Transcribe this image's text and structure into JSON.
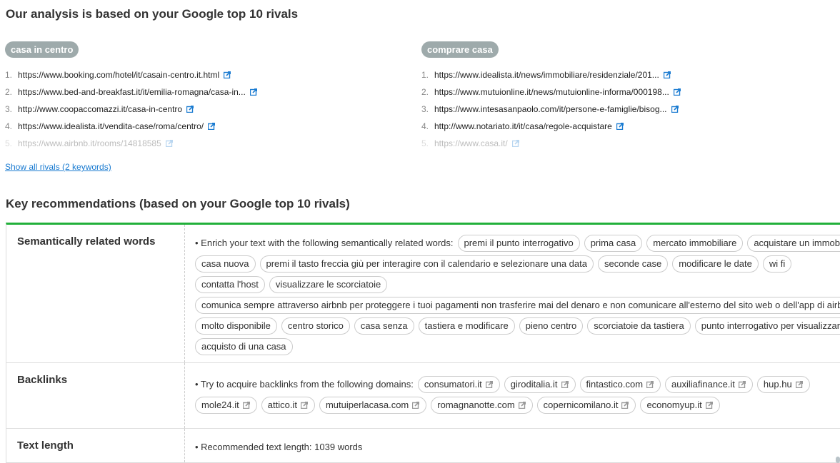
{
  "analysis_title": "Our analysis is based on your Google top 10 rivals",
  "rivals": [
    {
      "keyword": "casa in centro",
      "urls": [
        "https://www.booking.com/hotel/it/casain-centro.it.html",
        "https://www.bed-and-breakfast.it/it/emilia-romagna/casa-in...",
        "http://www.coopaccomazzi.it/casa-in-centro",
        "https://www.idealista.it/vendita-case/roma/centro/",
        "https://www.airbnb.it/rooms/14818585"
      ]
    },
    {
      "keyword": "comprare casa",
      "urls": [
        "https://www.idealista.it/news/immobiliare/residenziale/201...",
        "https://www.mutuionline.it/news/mutuionline-informa/000198...",
        "https://www.intesasanpaolo.com/it/persone-e-famiglie/bisog...",
        "http://www.notariato.it/it/casa/regole-acquistare",
        "https://www.casa.it/"
      ]
    }
  ],
  "numbers": [
    "1.",
    "2.",
    "3.",
    "4.",
    "5."
  ],
  "show_all": "Show all rivals (2 keywords)",
  "recommendations_title": "Key recommendations (based on your Google top 10 rivals)",
  "accent_color": "#21b03a",
  "link_color": "#1a7bd1",
  "sections": {
    "semantic": {
      "label": "Semantically related words",
      "lead": "• Enrich your text with the following semantically related words:",
      "words": [
        "premi il punto interrogativo",
        "prima casa",
        "mercato immobiliare",
        "acquistare un immobile",
        "casa nuova",
        "premi il tasto freccia giù per interagire con il calendario e selezionare una data",
        "seconde case",
        "modificare le date",
        "wi fi",
        "contatta l'host",
        "visualizzare le scorciatoie",
        "comunica sempre attraverso airbnb per proteggere i tuoi pagamenti non trasferire mai del denaro e non comunicare all'esterno del sito web o dell'app di airbnb",
        "molto disponibile",
        "centro storico",
        "casa senza",
        "tastiera e modificare",
        "pieno centro",
        "scorciatoie da tastiera",
        "punto interrogativo per visualizzare",
        "acquisto di una casa"
      ]
    },
    "backlinks": {
      "label": "Backlinks",
      "lead": "• Try to acquire backlinks from the following domains:",
      "domains": [
        "consumatori.it",
        "giroditalia.it",
        "fintastico.com",
        "auxiliafinance.it",
        "hup.hu",
        "mole24.it",
        "attico.it",
        "mutuiperlacasa.com",
        "romagnanotte.com",
        "copernicomilano.it",
        "economyup.it"
      ]
    },
    "text_length": {
      "label": "Text length",
      "lead": "• Recommended text length:",
      "value": "1039 words"
    }
  }
}
